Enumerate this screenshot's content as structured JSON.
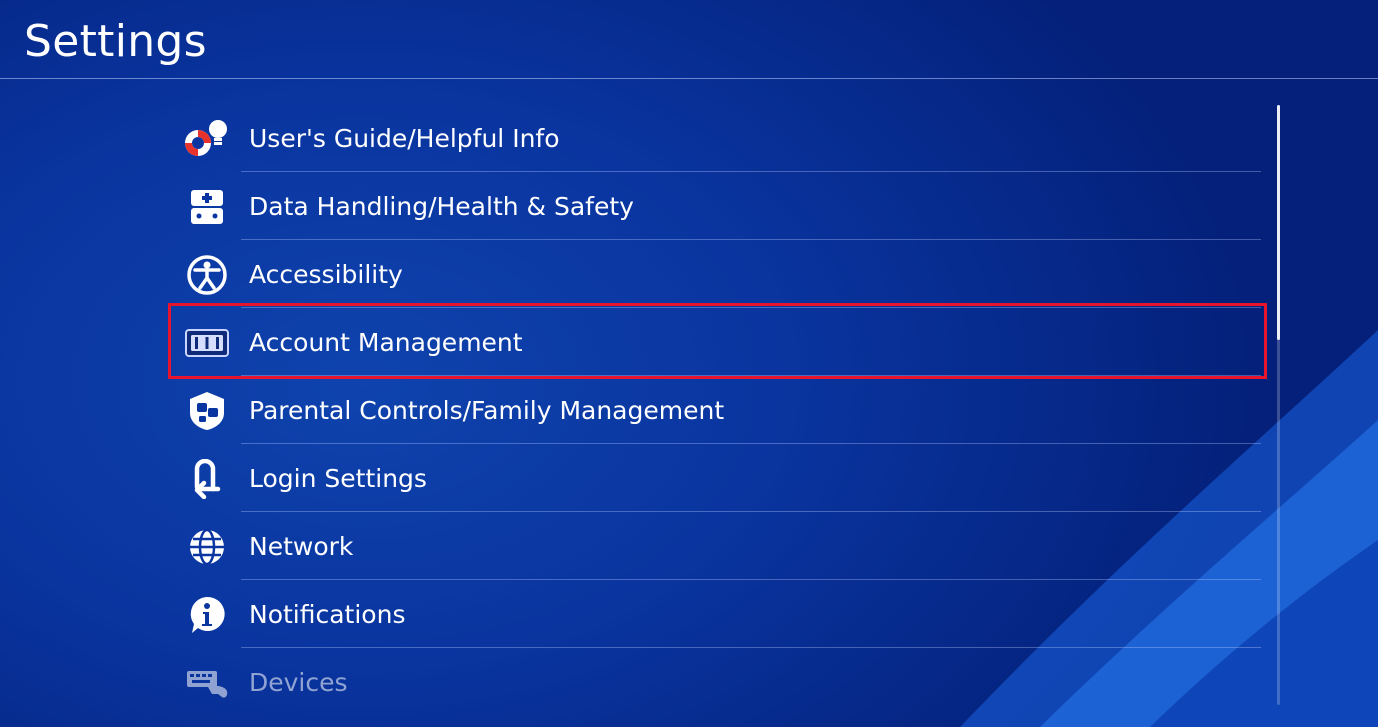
{
  "header": {
    "title": "Settings"
  },
  "menu": {
    "items": [
      {
        "label": "User's Guide/Helpful Info",
        "icon": "lifebuoy-bulb-icon"
      },
      {
        "label": "Data Handling/Health & Safety",
        "icon": "first-aid-case-icon"
      },
      {
        "label": "Accessibility",
        "icon": "accessibility-person-icon"
      },
      {
        "label": "Account Management",
        "icon": "id-card-icon"
      },
      {
        "label": "Parental Controls/Family Management",
        "icon": "family-shield-icon"
      },
      {
        "label": "Login Settings",
        "icon": "login-arrow-icon"
      },
      {
        "label": "Network",
        "icon": "globe-icon"
      },
      {
        "label": "Notifications",
        "icon": "info-bubble-icon"
      },
      {
        "label": "Devices",
        "icon": "keyboard-controller-icon"
      }
    ],
    "selected_index": 3
  },
  "colors": {
    "background": "#0a35a0",
    "highlight": "#e8132d",
    "text": "#ffffff"
  }
}
